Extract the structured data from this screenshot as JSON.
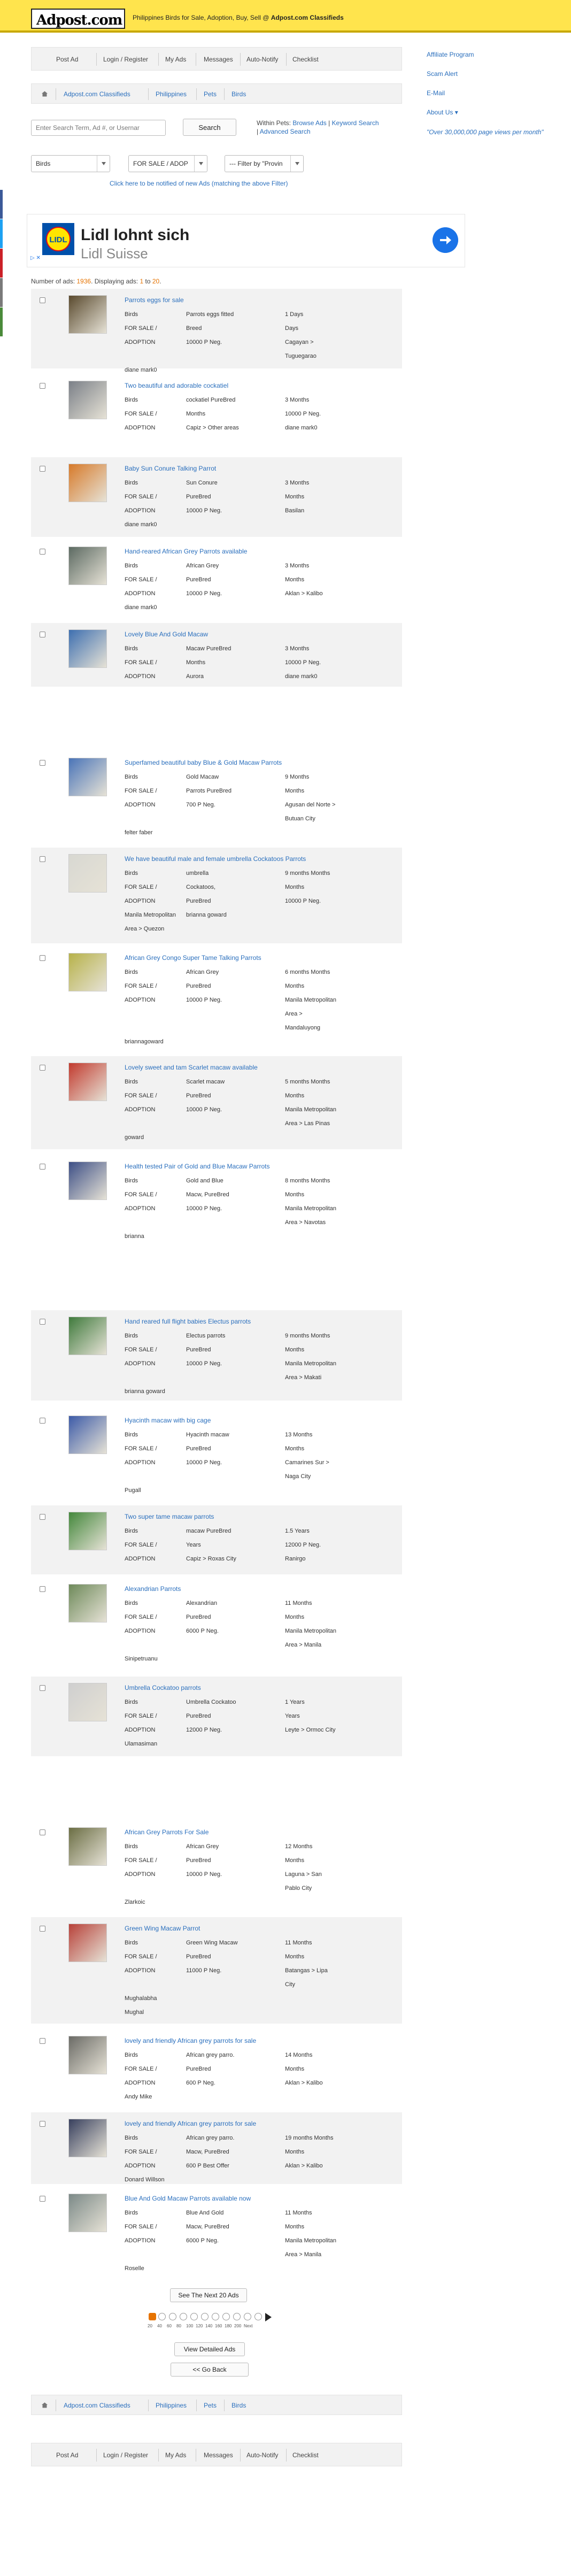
{
  "header": {
    "logo_text": "Adpost.com",
    "tagline_prefix": "Philippines Birds for Sale, Adoption, Buy, Sell @ ",
    "tagline_bold": "Adpost.com Classifieds"
  },
  "topnav": {
    "items": [
      "Post Ad",
      "Login / Register",
      "My Ads",
      "Messages",
      "Auto-Notify",
      "Checklist"
    ]
  },
  "breadcrumb": {
    "items": [
      "Adpost.com Classifieds",
      "Philippines",
      "Pets",
      "Birds"
    ]
  },
  "search": {
    "placeholder": "Enter Search Term, Ad #, or Usernar",
    "button_label": "Search",
    "within_label": "Within Pets:",
    "browse_ads": "Browse Ads",
    "keyword_search": "Keyword Search",
    "advanced_search": "Advanced Search"
  },
  "filters": {
    "category": "Birds",
    "type": "FOR SALE / ADOP",
    "province": "--- Filter by \"Provin"
  },
  "notify_link": "Click here to be notified of new Ads (matching the above Filter)",
  "sidebar": {
    "affiliate": "Affiliate Program",
    "scam": "Scam Alert",
    "email": "E-Mail",
    "about": "About Us",
    "quote": "\"Over 30,000,000 page views per month\""
  },
  "ad_banner": {
    "title": "Lidl lohnt sich",
    "subtitle": "Lidl Suisse",
    "corner": "▷ ✕"
  },
  "count": {
    "label": "Number of ads: ",
    "total": "1936",
    "middle": ". Displaying ads: ",
    "from": "1",
    "to_word": " to ",
    "to": "20",
    "end": "."
  },
  "listings": [
    {
      "title": "Parrots eggs for sale",
      "type": "Birds",
      "status": "FOR SALE /",
      "adoption": "ADOPTION",
      "c2": [
        "Parrots eggs fitted",
        "Breed",
        "10000 P Neg."
      ],
      "c3": [
        "1 Days",
        "Days",
        "Cagayan >",
        "Tuguegarao"
      ],
      "user": "diane mark0"
    },
    {
      "title": "Two beautiful and adorable cockatiel",
      "type": "Birds",
      "status": "FOR SALE /",
      "adoption": "ADOPTION",
      "c2": [
        "cockatiel PureBred",
        "Months",
        "Capiz > Other areas"
      ],
      "c3": [
        "3 Months",
        "10000 P Neg.",
        "diane mark0"
      ],
      "user": ""
    },
    {
      "title": "Baby Sun Conure Talking Parrot",
      "type": "Birds",
      "status": "FOR SALE /",
      "adoption": "ADOPTION",
      "c2": [
        "Sun Conure",
        "PureBred",
        "10000 P Neg."
      ],
      "c3": [
        "3 Months",
        "Months",
        "Basilan"
      ],
      "user": "diane mark0"
    },
    {
      "title": "Hand-reared African Grey Parrots available",
      "type": "Birds",
      "status": "FOR SALE /",
      "adoption": "ADOPTION",
      "c2": [
        "African Grey",
        "PureBred",
        "10000 P Neg."
      ],
      "c3": [
        "3 Months",
        "Months",
        "Aklan > Kalibo"
      ],
      "user": "diane mark0"
    },
    {
      "title": "Lovely Blue And Gold Macaw",
      "type": "Birds",
      "status": "FOR SALE /",
      "adoption": "ADOPTION",
      "c2": [
        "Macaw PureBred",
        "Months",
        "Aurora"
      ],
      "c3": [
        "3 Months",
        "10000 P Neg.",
        "diane mark0"
      ],
      "user": ""
    },
    {
      "title": "Superfamed beautiful baby Blue & Gold Macaw Parrots",
      "type": "Birds",
      "status": "FOR SALE /",
      "adoption": "ADOPTION",
      "c2": [
        "Gold Macaw",
        "Parrots PureBred",
        "700 P Neg."
      ],
      "c3": [
        "9 Months",
        "Months",
        "Agusan del Norte >",
        "Butuan City"
      ],
      "user": "felter faber"
    },
    {
      "title": "We have beautiful male and female umbrella Cockatoos Parrots",
      "type": "Birds",
      "status": "FOR SALE /",
      "adoption": "ADOPTION",
      "c2": [
        "umbrella",
        "Cockatoos,",
        "PureBred"
      ],
      "c3": [
        "9 months Months",
        "Months",
        "10000 P Neg."
      ],
      "user": "Manila Metropolitan",
      "user2": "Area > Quezon",
      "user_mid": "brianna goward"
    },
    {
      "title": "African Grey Congo Super Tame Talking Parrots",
      "type": "Birds",
      "status": "FOR SALE /",
      "adoption": "ADOPTION",
      "c2": [
        "African Grey",
        "PureBred",
        "10000 P Neg."
      ],
      "c3": [
        "6 months Months",
        "Months",
        "Manila Metropolitan",
        "Area >",
        "Mandaluyong"
      ],
      "user": "briannagoward"
    },
    {
      "title": "Lovely sweet and tam Scarlet macaw available",
      "type": "Birds",
      "status": "FOR SALE /",
      "adoption": "ADOPTION",
      "c2": [
        "Scarlet macaw",
        "PureBred",
        "10000 P Neg."
      ],
      "c3": [
        "5 months Months",
        "Months",
        "Manila Metropolitan",
        "Area > Las Pinas"
      ],
      "user": "goward"
    },
    {
      "title": "Health tested Pair of Gold and Blue Macaw Parrots",
      "type": "Birds",
      "status": "FOR SALE /",
      "adoption": "ADOPTION",
      "c2": [
        "Gold and Blue",
        "Macw, PureBred",
        "10000 P Neg."
      ],
      "c3": [
        "8 months Months",
        "Months",
        "Manila Metropolitan",
        "Area > Navotas"
      ],
      "user": "brianna"
    },
    {
      "title": "Hand reared full flight babies Electus parrots",
      "type": "Birds",
      "status": "FOR SALE /",
      "adoption": "ADOPTION",
      "c2": [
        "Electus parrots",
        "PureBred",
        "10000 P Neg."
      ],
      "c3": [
        "9 months Months",
        "Months",
        "Manila Metropolitan",
        "Area > Makati"
      ],
      "user": "brianna goward"
    },
    {
      "title": "Hyacinth macaw with big cage",
      "type": "Birds",
      "status": "FOR SALE /",
      "adoption": "ADOPTION",
      "c2": [
        "Hyacinth macaw",
        "PureBred",
        "10000 P Neg."
      ],
      "c3": [
        "13 Months",
        "Months",
        "Camarines Sur >",
        "Naga City"
      ],
      "user": "Pugall"
    },
    {
      "title": "Two super tame macaw parrots",
      "type": "Birds",
      "status": "FOR SALE /",
      "adoption": "ADOPTION",
      "c2": [
        "macaw PureBred",
        "Years",
        "Capiz > Roxas City"
      ],
      "c3": [
        "1.5 Years",
        "12000 P Neg.",
        "Ranirgo"
      ],
      "user": ""
    },
    {
      "title": "Alexandrian Parrots",
      "type": "Birds",
      "status": "FOR SALE /",
      "adoption": "ADOPTION",
      "c2": [
        "Alexandrian",
        "PureBred",
        "6000 P Neg."
      ],
      "c3": [
        "11 Months",
        "Months",
        "Manila Metropolitan",
        "Area > Manila"
      ],
      "user": "Sinipetruanu"
    },
    {
      "title": "Umbrella Cockatoo parrots",
      "type": "Birds",
      "status": "FOR SALE /",
      "adoption": "ADOPTION",
      "c2": [
        "Umbrella Cockatoo",
        "PureBred",
        "12000 P Neg."
      ],
      "c3": [
        "1 Years",
        "Years",
        "Leyte > Ormoc City"
      ],
      "user": "Ulamasiman"
    },
    {
      "title": "African Grey Parrots For Sale",
      "type": "Birds",
      "status": "FOR SALE /",
      "adoption": "ADOPTION",
      "c2": [
        "African Grey",
        "PureBred",
        "10000 P Neg."
      ],
      "c3": [
        "12 Months",
        "Months",
        "Laguna > San",
        "Pablo City"
      ],
      "user": "Zlarkoic"
    },
    {
      "title": "Green Wing Macaw Parrot",
      "type": "Birds",
      "status": "FOR SALE /",
      "adoption": "ADOPTION",
      "c2": [
        "Green Wing Macaw",
        "PureBred",
        "11000 P Neg."
      ],
      "c3": [
        "11 Months",
        "Months",
        "Batangas > Lipa",
        "City"
      ],
      "user": "Mughalabha",
      "user2": "Mughal"
    },
    {
      "title": "lovely and friendly African grey parrots for sale",
      "type": "Birds",
      "status": "FOR SALE /",
      "adoption": "ADOPTION",
      "c2": [
        "African grey parro.",
        "PureBred",
        "600 P Neg."
      ],
      "c3": [
        "14 Months",
        "Months",
        "Aklan > Kalibo"
      ],
      "user": "Andy Mike"
    },
    {
      "title": "lovely and friendly African grey parrots for sale",
      "type": "Birds",
      "status": "FOR SALE /",
      "adoption": "ADOPTION",
      "c2": [
        "African grey parro.",
        "Macw, PureBred",
        "600 P Best Offer"
      ],
      "c3": [
        "19 months Months",
        "Months",
        "Aklan > Kalibo"
      ],
      "user": "Donard Willson"
    },
    {
      "title": "Blue And Gold Macaw Parrots available now",
      "type": "Birds",
      "status": "FOR SALE /",
      "adoption": "ADOPTION",
      "c2": [
        "Blue And Gold",
        "Macw, PureBred",
        "6000 P Neg."
      ],
      "c3": [
        "11 Months",
        "Months",
        "Manila Metropolitan",
        "Area > Manila"
      ],
      "user": "Roselle"
    }
  ],
  "bottom": {
    "next_label": "See The Next 20 Ads",
    "pager_nums": [
      "20",
      "40",
      "60",
      "80",
      "100",
      "120",
      "140",
      "160",
      "180",
      "200",
      "Next"
    ],
    "detailed_label": "View Detailed Ads",
    "back_label": "<< Go Back"
  },
  "colors": {
    "header_bg": "#ffe44d",
    "link": "#2a6fbd",
    "row_alt": "#f2f2f2",
    "highlight": "#e67300"
  }
}
